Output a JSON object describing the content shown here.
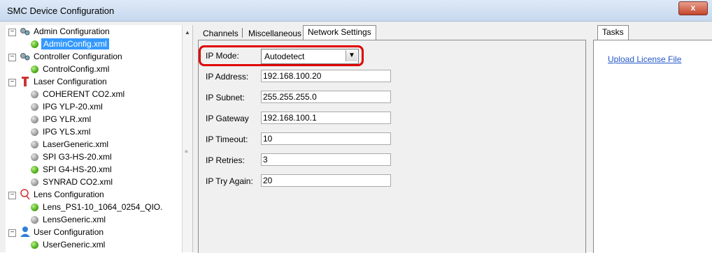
{
  "window": {
    "title": "SMC Device Configuration",
    "close_glyph": "x"
  },
  "tree": {
    "nodes": [
      {
        "label": "Admin Configuration",
        "expander": "−",
        "icon": "gear-icon"
      },
      {
        "label": "AdminConfig.xml",
        "bullet": "green",
        "selected": true
      },
      {
        "label": "Controller Configuration",
        "expander": "−",
        "icon": "gear-icon"
      },
      {
        "label": "ControlConfig.xml",
        "bullet": "green"
      },
      {
        "label": "Laser Configuration",
        "expander": "−",
        "icon": "laser-icon"
      },
      {
        "label": "COHERENT CO2.xml",
        "bullet": "gray"
      },
      {
        "label": "IPG YLP-20.xml",
        "bullet": "gray"
      },
      {
        "label": "IPG YLR.xml",
        "bullet": "gray"
      },
      {
        "label": "IPG YLS.xml",
        "bullet": "gray"
      },
      {
        "label": "LaserGeneric.xml",
        "bullet": "gray"
      },
      {
        "label": "SPI G3-HS-20.xml",
        "bullet": "gray"
      },
      {
        "label": "SPI G4-HS-20.xml",
        "bullet": "green"
      },
      {
        "label": "SYNRAD CO2.xml",
        "bullet": "gray"
      },
      {
        "label": "Lens Configuration",
        "expander": "−",
        "icon": "lens-icon"
      },
      {
        "label": "Lens_PS1-10_1064_0254_QIO.",
        "bullet": "green"
      },
      {
        "label": "LensGeneric.xml",
        "bullet": "gray"
      },
      {
        "label": "User Configuration",
        "expander": "−",
        "icon": "user-icon"
      },
      {
        "label": "UserGeneric.xml",
        "bullet": "green"
      }
    ]
  },
  "tabs": {
    "channels": "Channels",
    "miscellaneous": "Miscellaneous",
    "network_settings": "Network Settings",
    "active": "Network Settings"
  },
  "network": {
    "ip_mode_label": "IP Mode:",
    "ip_mode_value": "Autodetect",
    "ip_address_label": "IP Address:",
    "ip_address_value": "192.168.100.20",
    "ip_subnet_label": "IP Subnet:",
    "ip_subnet_value": "255.255.255.0",
    "ip_gateway_label": "IP Gateway",
    "ip_gateway_value": "192.168.100.1",
    "ip_timeout_label": "IP Timeout:",
    "ip_timeout_value": "10",
    "ip_retries_label": "IP Retries:",
    "ip_retries_value": "3",
    "ip_try_again_label": "IP Try Again:",
    "ip_try_again_value": "20"
  },
  "tasks": {
    "tab_label": "Tasks",
    "upload_license": "Upload License File"
  },
  "colors": {
    "selection": "#3399ff",
    "highlight": "#e00000",
    "link": "#2456c8"
  }
}
